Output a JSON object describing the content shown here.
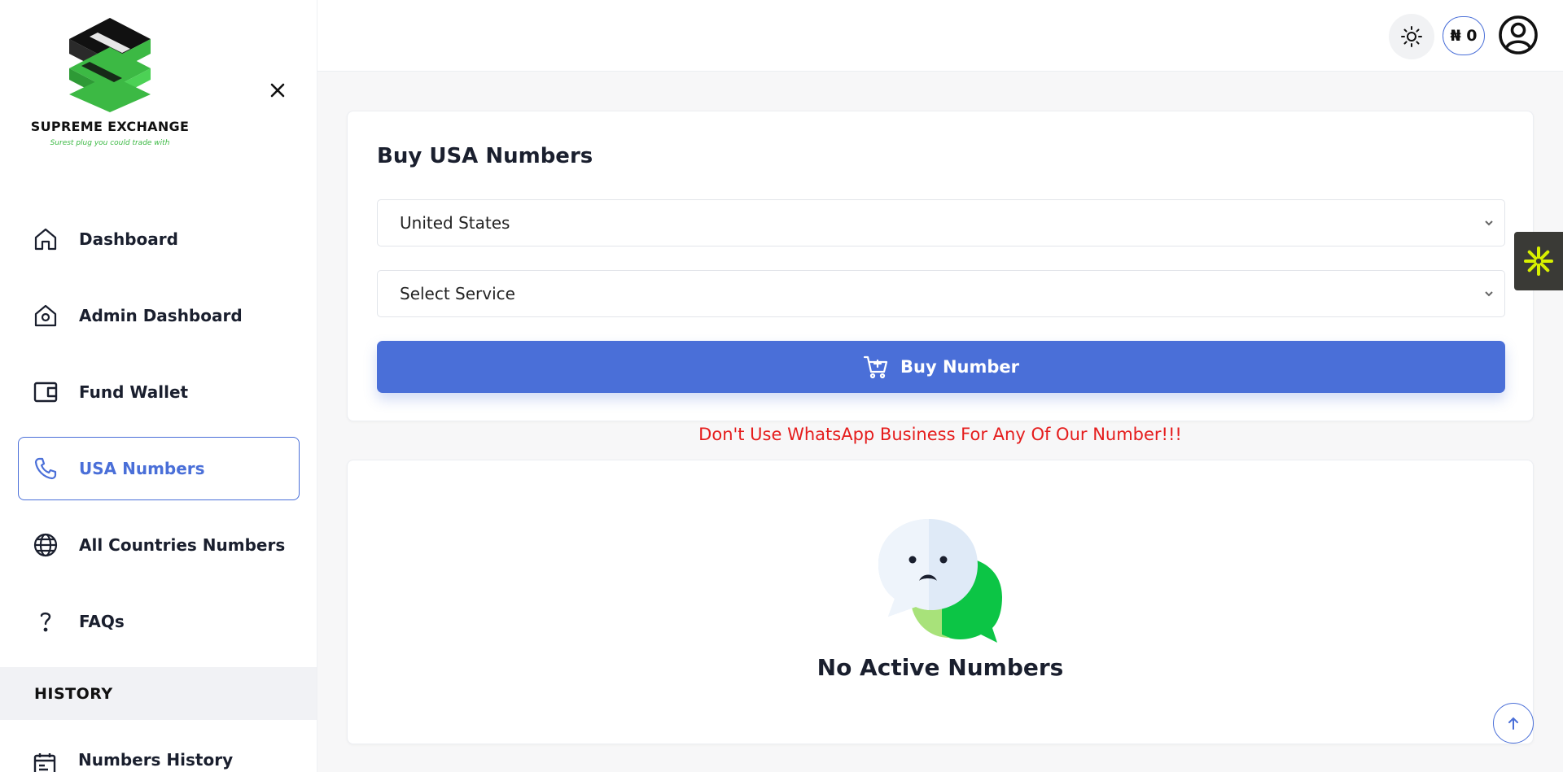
{
  "brand": {
    "name": "SUPREME EXCHANGE",
    "tagline": "Surest plug you could trade with",
    "logo_icon": "se-logo-icon",
    "colors": {
      "green": "#3cb944",
      "black": "#111111"
    }
  },
  "sidebar": {
    "items": [
      {
        "label": "Dashboard",
        "icon": "home-icon"
      },
      {
        "label": "Admin Dashboard",
        "icon": "admin-home-icon"
      },
      {
        "label": "Fund Wallet",
        "icon": "wallet-icon"
      },
      {
        "label": "USA Numbers",
        "icon": "phone-icon",
        "active": true
      },
      {
        "label": "All Countries Numbers",
        "icon": "globe-icon"
      },
      {
        "label": "FAQs",
        "icon": "question-icon"
      }
    ],
    "history_header": "HISTORY",
    "history_items": [
      {
        "label": "Numbers History",
        "icon": "calendar-icon"
      }
    ]
  },
  "topbar": {
    "balance": "₦ 0",
    "theme_icon": "sun-icon",
    "avatar_icon": "user-circle-icon"
  },
  "buy": {
    "title": "Buy USA Numbers",
    "country_value": "United States",
    "service_value": "Select Service",
    "button_label": "Buy Number",
    "button_icon": "cart-plus-icon"
  },
  "warning": "Don't Use WhatsApp Business For Any Of Our Number!!!",
  "empty": {
    "text": "No Active Numbers",
    "icon": "sad-chat-bubble-icon"
  },
  "colors": {
    "accent": "#4a6fd8",
    "warning": "#e51c1c",
    "widget": "#3a3a36",
    "widget_icon": "#d8f000"
  }
}
